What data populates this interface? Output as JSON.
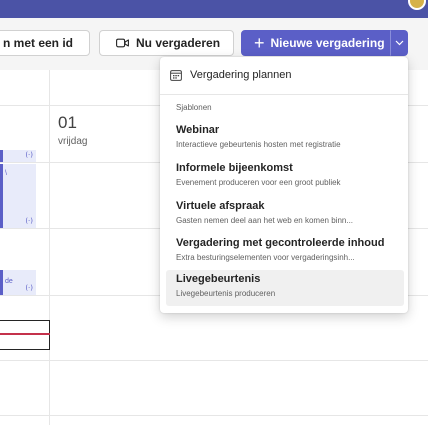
{
  "toolbar": {
    "join_with_id_label": "n met een id",
    "meet_now_label": "Nu vergaderen",
    "new_meeting_label": "Nieuwe vergadering",
    "new_meeting_plus": "+",
    "chevron": "⌄"
  },
  "calendar": {
    "day_number": "01",
    "day_name": "vrijdag",
    "event_icon": "(·)",
    "event_truncated_text": "de",
    "event_truncated_text_2": "\\"
  },
  "menu": {
    "plan_label": "Vergadering plannen",
    "section_label": "Sjablonen",
    "templates": [
      {
        "title": "Webinar",
        "description": "Interactieve gebeurtenis hosten met registratie"
      },
      {
        "title": "Informele bijeenkomst",
        "description": "Evenement produceren voor een groot publiek"
      },
      {
        "title": "Virtuele afspraak",
        "description": "Gasten nemen deel aan het web en komen binn..."
      },
      {
        "title": "Vergadering met gecontroleerde inhoud",
        "description": "Extra besturingselementen voor vergaderingsinh..."
      },
      {
        "title": "Livegebeurtenis",
        "description": "Livegebeurtenis produceren"
      }
    ]
  },
  "colors": {
    "brand": "#5b5fc7",
    "topbar": "#4b53a6",
    "now_indicator": "#c4314b"
  }
}
